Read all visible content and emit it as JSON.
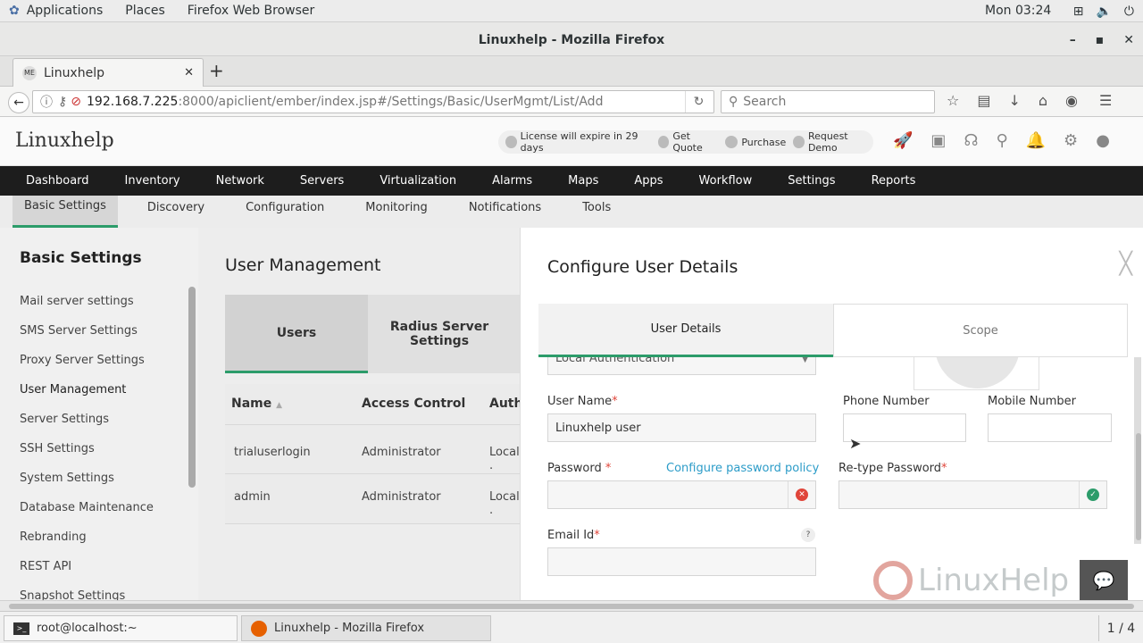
{
  "system": {
    "menu": [
      "Applications",
      "Places",
      "Firefox Web Browser"
    ],
    "clock": "Mon 03:24"
  },
  "window": {
    "title": "Linuxhelp - Mozilla Firefox"
  },
  "browser": {
    "tab_label": "Linuxhelp",
    "url_host": "192.168.7.225",
    "url_rest": ":8000/apiclient/ember/index.jsp#/Settings/Basic/UserMgmt/List/Add",
    "search_placeholder": "Search"
  },
  "app": {
    "brand": "Linuxhelp",
    "license": "License will expire in 29 days",
    "get_quote": "Get Quote",
    "purchase": "Purchase",
    "request_demo": "Request Demo",
    "menu": [
      "Dashboard",
      "Inventory",
      "Network",
      "Servers",
      "Virtualization",
      "Alarms",
      "Maps",
      "Apps",
      "Workflow",
      "Settings",
      "Reports"
    ],
    "submenu": [
      "Basic Settings",
      "Discovery",
      "Configuration",
      "Monitoring",
      "Notifications",
      "Tools"
    ]
  },
  "sidebar": {
    "title": "Basic Settings",
    "items": [
      "Mail server settings",
      "SMS Server Settings",
      "Proxy Server Settings",
      "User Management",
      "Server Settings",
      "SSH Settings",
      "System Settings",
      "Database Maintenance",
      "Rebranding",
      "REST API",
      "Snapshot Settings"
    ]
  },
  "page": {
    "title": "User Management",
    "tab_users": "Users",
    "tab_radius": "Radius Server Settings",
    "columns": [
      "Name",
      "Access Control",
      "Auth"
    ],
    "rows": [
      {
        "name": "trialuserlogin",
        "access": "Administrator",
        "auth": "Local ."
      },
      {
        "name": "admin",
        "access": "Administrator",
        "auth": "Local ."
      }
    ]
  },
  "modal": {
    "title": "Configure User Details",
    "tab_user_details": "User Details",
    "tab_scope": "Scope",
    "auth_value": "Local Authentication",
    "username_label": "User Name",
    "username_value": "Linuxhelp user",
    "phone_label": "Phone Number",
    "mobile_label": "Mobile Number",
    "password_label": "Password",
    "password_policy_link": "Configure password policy",
    "retype_label": "Re-type Password",
    "email_label": "Email Id"
  },
  "taskbar": {
    "terminal": "root@localhost:~",
    "firefox": "Linuxhelp - Mozilla Firefox",
    "pager": "1 / 4"
  },
  "watermark": "LinuxHelp"
}
